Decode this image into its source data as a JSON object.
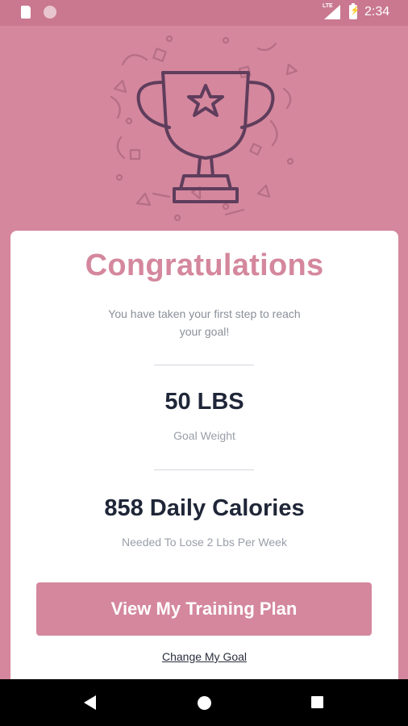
{
  "status_bar": {
    "network": "LTE",
    "time": "2:34",
    "battery_level": "charging"
  },
  "hero": {
    "icon": "trophy-icon",
    "background_color": "#d4879d"
  },
  "card": {
    "title": "Congratulations",
    "subtitle": "You have taken your first step to reach your goal!",
    "stats": [
      {
        "value": "50 LBS",
        "label": "Goal Weight"
      },
      {
        "value": "858 Daily Calories",
        "label": "Needed To Lose 2 Lbs Per Week"
      }
    ],
    "primary_button": "View My Training Plan",
    "secondary_link": "Change My Goal"
  },
  "colors": {
    "accent": "#d4879d",
    "dark_text": "#1f2638",
    "muted_text": "#8a8f99"
  },
  "nav_bar": {
    "icons": [
      "back-icon",
      "home-icon",
      "recents-icon"
    ]
  }
}
